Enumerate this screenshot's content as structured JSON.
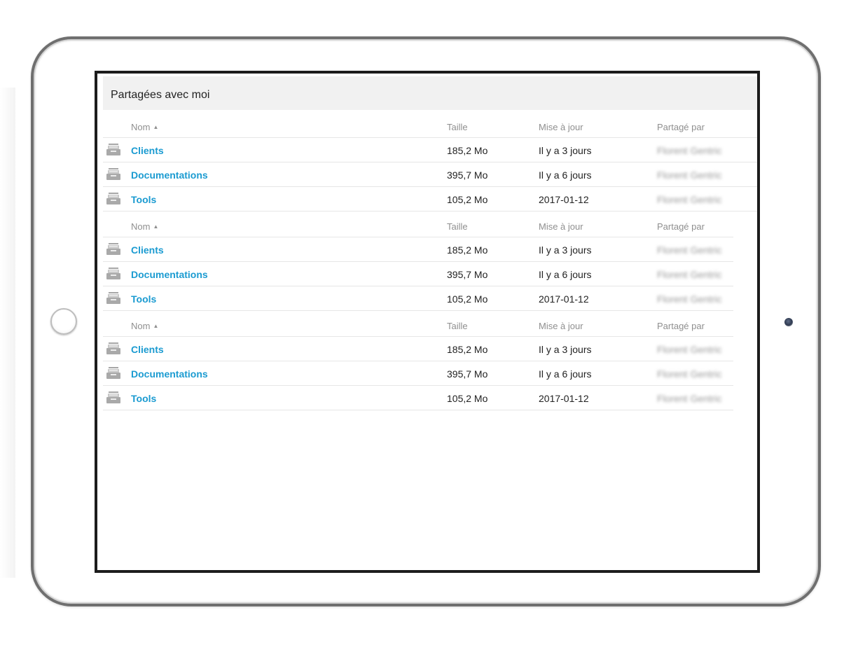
{
  "panel": {
    "title": "Partagées avec moi"
  },
  "columns": {
    "name": "Nom",
    "size": "Taille",
    "updated": "Mise à jour",
    "shared_by": "Partagé par",
    "sort_indicator": "▲"
  },
  "icons": {
    "folder": "shared-folder-icon",
    "sort": "sort-ascending-icon"
  },
  "colors": {
    "link": "#1b9bd1",
    "header_bar": "#f1f1f1",
    "muted_text": "#8f8f8f"
  },
  "groups": [
    {
      "rows": [
        {
          "name": "Clients",
          "size": "185,2 Mo",
          "updated": "Il y a 3 jours",
          "shared_by": "Florent Gentric"
        },
        {
          "name": "Documentations",
          "size": "395,7 Mo",
          "updated": "Il y a 6 jours",
          "shared_by": "Florent Gentric"
        },
        {
          "name": "Tools",
          "size": "105,2 Mo",
          "updated": "2017-01-12",
          "shared_by": "Florent Gentric"
        }
      ]
    },
    {
      "rows": [
        {
          "name": "Clients",
          "size": "185,2 Mo",
          "updated": "Il y a 3 jours",
          "shared_by": "Florent Gentric"
        },
        {
          "name": "Documentations",
          "size": "395,7 Mo",
          "updated": "Il y a 6 jours",
          "shared_by": "Florent Gentric"
        },
        {
          "name": "Tools",
          "size": "105,2 Mo",
          "updated": "2017-01-12",
          "shared_by": "Florent Gentric"
        }
      ]
    },
    {
      "rows": [
        {
          "name": "Clients",
          "size": "185,2 Mo",
          "updated": "Il y a 3 jours",
          "shared_by": "Florent Gentric"
        },
        {
          "name": "Documentations",
          "size": "395,7 Mo",
          "updated": "Il y a 6 jours",
          "shared_by": "Florent Gentric"
        },
        {
          "name": "Tools",
          "size": "105,2 Mo",
          "updated": "2017-01-12",
          "shared_by": "Florent Gentric"
        }
      ]
    }
  ]
}
